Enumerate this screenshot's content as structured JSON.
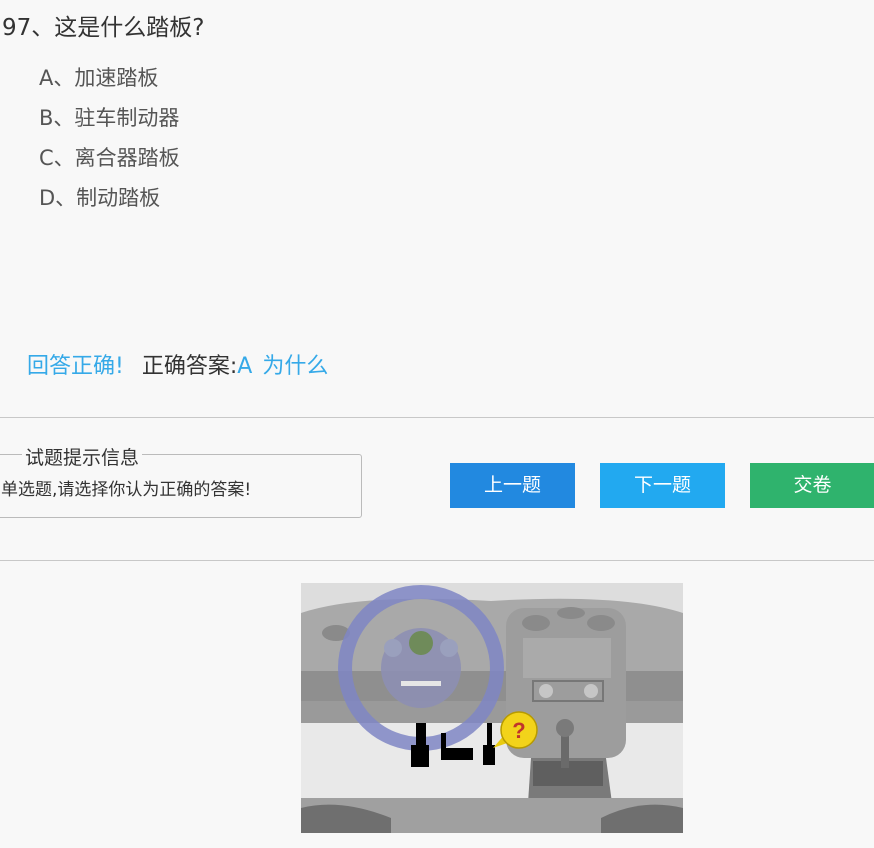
{
  "question": {
    "text": "97、这是什么踏板?"
  },
  "options": [
    {
      "label": "A、加速踏板"
    },
    {
      "label": "B、驻车制动器"
    },
    {
      "label": "C、离合器踏板"
    },
    {
      "label": "D、制动踏板"
    }
  ],
  "result": {
    "status": "回答正确!",
    "answer_label": "正确答案:",
    "answer": "A",
    "why_link": "为什么"
  },
  "hint": {
    "legend": "试题提示信息",
    "text": "单选题,请选择你认为正确的答案!"
  },
  "buttons": {
    "prev": "上一题",
    "next": "下一题",
    "submit": "交卷"
  },
  "image": {
    "callout": "?"
  },
  "colors": {
    "accent_blue": "#35a9e8",
    "prev": "#2289e0",
    "next": "#22a9f0",
    "submit": "#2fb36d"
  }
}
